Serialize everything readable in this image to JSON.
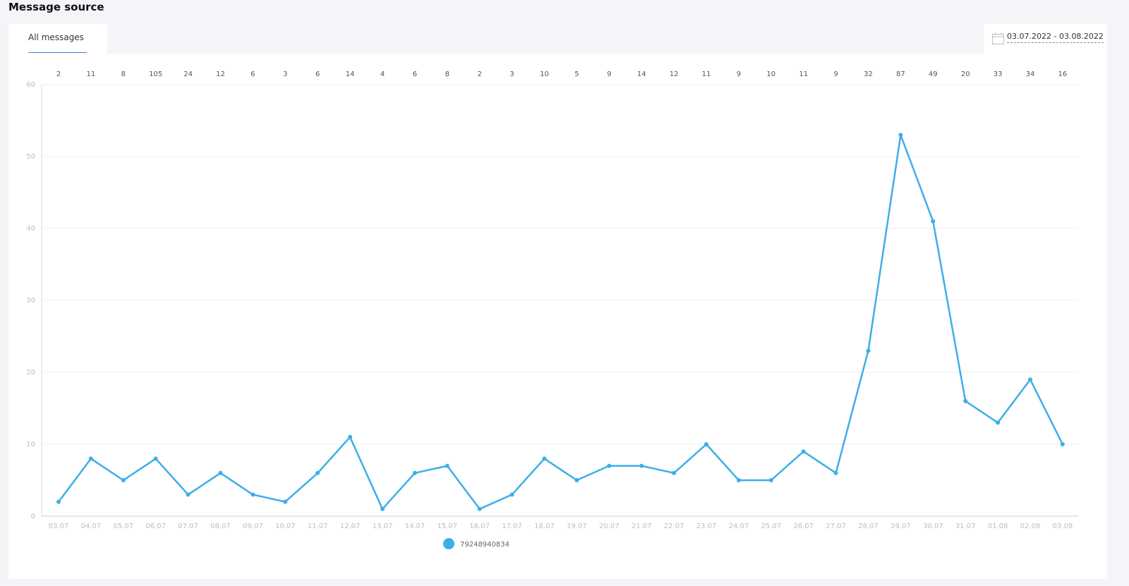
{
  "page": {
    "title": "Message source"
  },
  "tabs": [
    {
      "label": "All messages",
      "active": true
    }
  ],
  "date_range": {
    "label": "03.07.2022 - 03.08.2022",
    "icon": "calendar-icon"
  },
  "colors": {
    "series": "#3daee9",
    "grid": "#efefef",
    "accent": "#4a7bd8"
  },
  "chart_data": {
    "type": "line",
    "x": [
      "03.07",
      "04.07",
      "05.07",
      "06.07",
      "07.07",
      "08.07",
      "09.07",
      "10.07",
      "11.07",
      "12.07",
      "13.07",
      "14.07",
      "15.07",
      "16.07",
      "17.07",
      "18.07",
      "19.07",
      "20.07",
      "21.07",
      "22.07",
      "23.07",
      "24.07",
      "25.07",
      "26.07",
      "27.07",
      "28.07",
      "29.07",
      "30.07",
      "31.07",
      "01.08",
      "02.08",
      "03.08"
    ],
    "top_labels": [
      "2",
      "11",
      "8",
      "105",
      "24",
      "12",
      "6",
      "3",
      "6",
      "14",
      "4",
      "6",
      "8",
      "2",
      "3",
      "10",
      "5",
      "9",
      "14",
      "12",
      "11",
      "9",
      "10",
      "11",
      "9",
      "32",
      "87",
      "49",
      "20",
      "33",
      "34",
      "16"
    ],
    "series": [
      {
        "name": "79248940834",
        "values": [
          2,
          8,
          5,
          8,
          3,
          6,
          3,
          2,
          6,
          11,
          1,
          6,
          7,
          1,
          3,
          8,
          5,
          7,
          7,
          6,
          10,
          5,
          5,
          9,
          6,
          23,
          53,
          41,
          16,
          13,
          19,
          10
        ]
      }
    ],
    "ylim": [
      0,
      60
    ],
    "yticks": [
      "0",
      "10",
      "20",
      "30",
      "40",
      "50",
      "60"
    ],
    "grid": true,
    "legend": "bottom-center"
  }
}
